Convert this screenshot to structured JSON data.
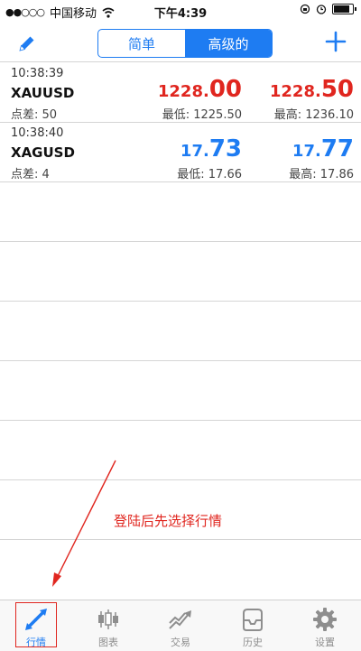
{
  "status_bar": {
    "signal": "●●○○○",
    "carrier": "中国移动",
    "time": "下午4:39",
    "icons": [
      "wifi-icon",
      "rotation-lock-icon",
      "alarm-icon",
      "battery-icon"
    ],
    "battery_level": 0.85
  },
  "nav": {
    "edit_icon": "pencil-icon",
    "segments": [
      "简单",
      "高级的"
    ],
    "active_segment": 1,
    "add_icon": "plus-icon"
  },
  "quotes": [
    {
      "time": "10:38:39",
      "symbol": "XAUUSD",
      "spread": "点差: 50",
      "bid_small": "1228.",
      "bid_big": "00",
      "ask_small": "1228.",
      "ask_big": "50",
      "low": "最低: 1225.50",
      "high": "最高: 1236.10",
      "color": "#e0261f"
    },
    {
      "time": "10:38:40",
      "symbol": "XAGUSD",
      "spread": "点差: 4",
      "bid_small": "17.",
      "bid_big": "73",
      "ask_small": "17.",
      "ask_big": "77",
      "low": "最低: 17.66",
      "high": "最高: 17.86",
      "color": "#1e7cf2"
    }
  ],
  "annotation": {
    "text": "登陆后先选择行情",
    "color": "#e0261f"
  },
  "tabs": [
    {
      "label": "行情",
      "icon": "quotes-arrows-icon",
      "active": true
    },
    {
      "label": "图表",
      "icon": "candlestick-chart-icon",
      "active": false
    },
    {
      "label": "交易",
      "icon": "trade-chart-icon",
      "active": false
    },
    {
      "label": "历史",
      "icon": "history-inbox-icon",
      "active": false
    },
    {
      "label": "设置",
      "icon": "gear-icon",
      "active": false
    }
  ],
  "colors": {
    "accent": "#1e7cf2",
    "price_up": "#e0261f",
    "price_down": "#1e7cf2"
  }
}
